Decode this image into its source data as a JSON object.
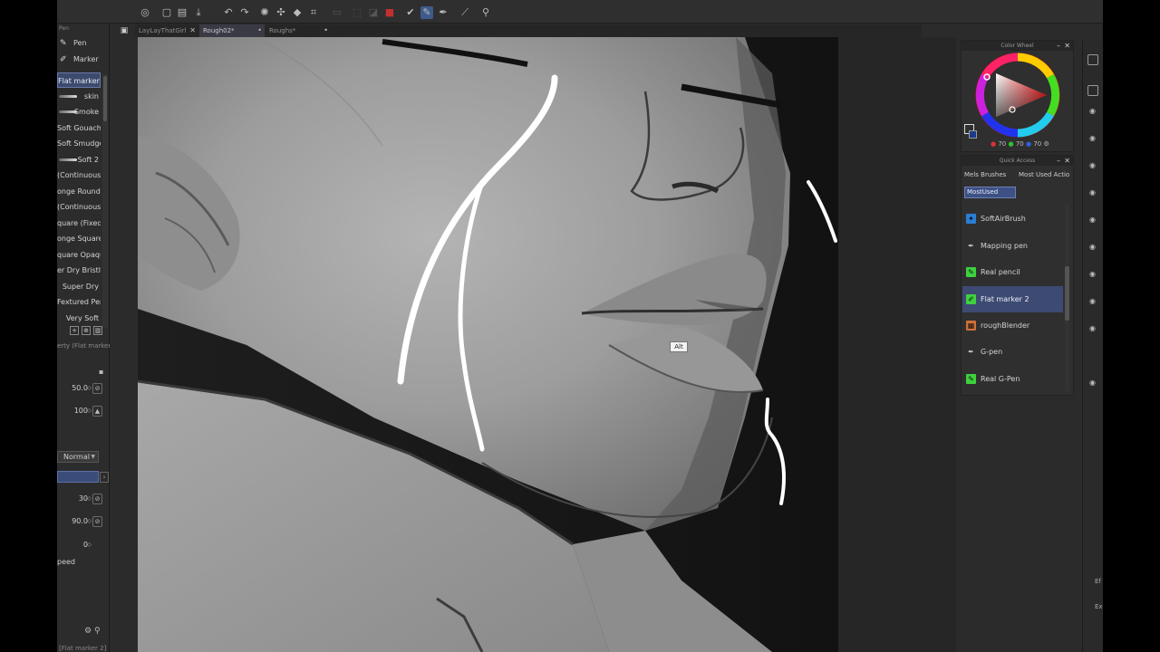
{
  "tabs": [
    {
      "label": "LayLayThatGirl",
      "active": false
    },
    {
      "label": "Rough02*",
      "active": true
    },
    {
      "label": "Roughs*",
      "active": false
    }
  ],
  "subtool": {
    "header": "Pen",
    "categories": [
      {
        "label": "Pen",
        "icon": "pen-icon"
      },
      {
        "label": "Marker",
        "icon": "marker-icon"
      }
    ],
    "brushes": [
      "Flat marker 2",
      "skin",
      "Smoke",
      "Soft Gouache",
      "Soft Smudge",
      "Soft 2",
      "(Continuous)",
      "onge Round",
      "(Continuous)",
      "quare (Fixed)",
      "onge Square",
      "quare Opaque",
      "er Dry Bristle",
      "Super Dry",
      "Fextured Pen",
      "Very Soft"
    ],
    "selected_index": 0
  },
  "property": {
    "header": "erty (Flat marker",
    "size": "50.0",
    "opacity": "100",
    "blend_mode": "Normal",
    "field_a": "30",
    "field_b": "90.0",
    "field_c": "0",
    "speed_label": "peed",
    "footer_label": "[Flat marker 2]"
  },
  "color_wheel": {
    "title": "Color Wheel",
    "h": "70",
    "s": "70",
    "v": "70"
  },
  "quick_access": {
    "title": "Quick Access",
    "tabs": [
      "Mels Brushes",
      "Most Used Actio"
    ],
    "set": "MostUsed",
    "items": [
      {
        "label": "SoftAirBrush",
        "color": "#2a7fd4",
        "icon": "airbrush-icon"
      },
      {
        "label": "Mapping pen",
        "color": "",
        "icon": "pen-nib-icon"
      },
      {
        "label": "Real pencil",
        "color": "#3ed13e",
        "icon": "pencil-icon"
      },
      {
        "label": "Flat marker 2",
        "color": "#3ed13e",
        "icon": "marker-icon"
      },
      {
        "label": "roughBlender",
        "color": "#d0703a",
        "icon": "blender-icon"
      },
      {
        "label": "G-pen",
        "color": "",
        "icon": "pen-nib-icon"
      },
      {
        "label": "Real G-Pen",
        "color": "#3ed13e",
        "icon": "pen-icon"
      }
    ],
    "selected_index": 3
  },
  "tooltip": "Alt",
  "edge_labels": [
    "Ef",
    "Ex"
  ]
}
